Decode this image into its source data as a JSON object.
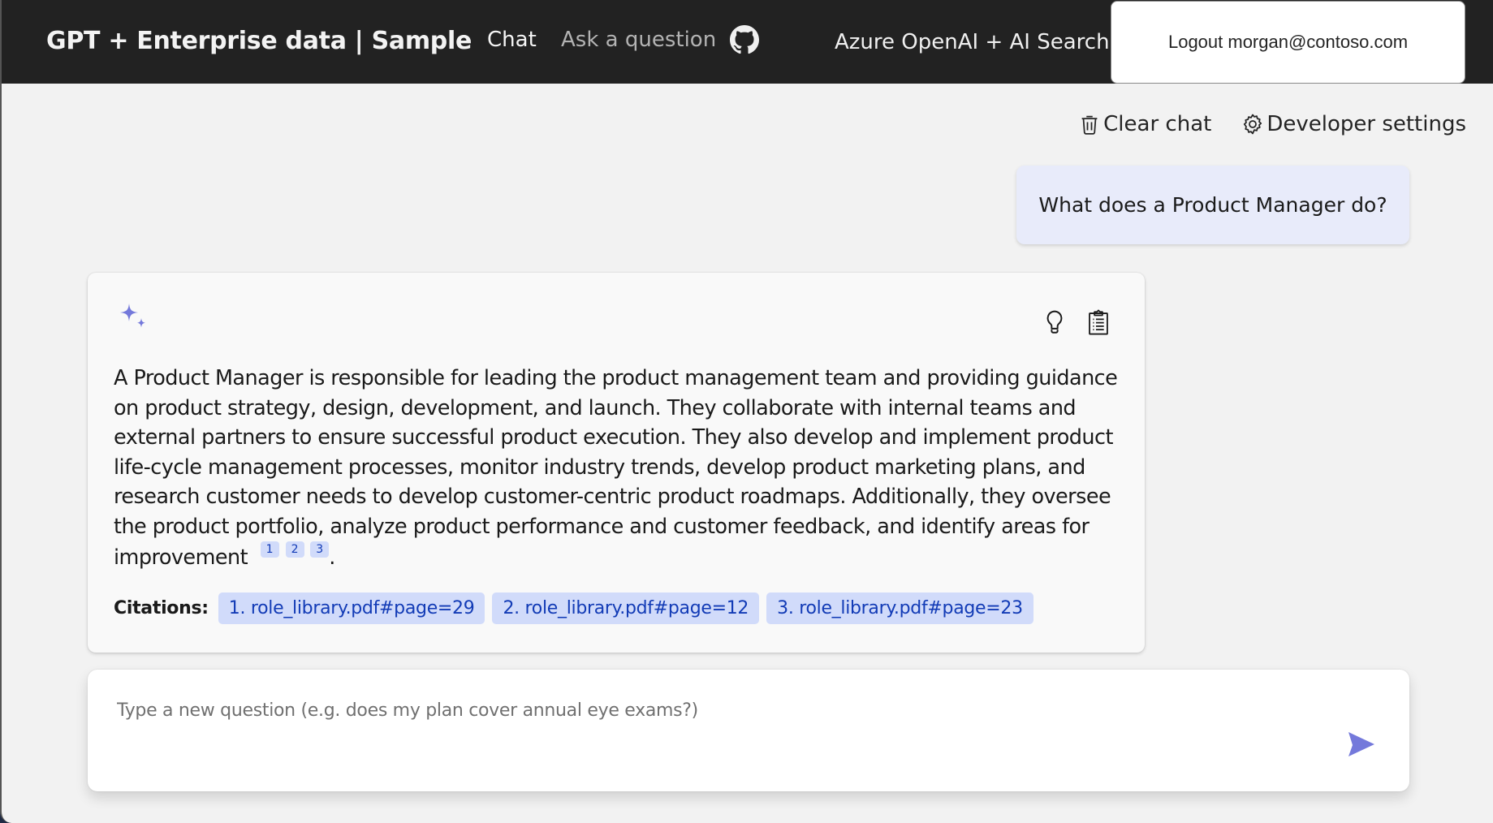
{
  "header": {
    "title": "GPT + Enterprise data | Sample",
    "nav": [
      {
        "label": "Chat",
        "active": true
      },
      {
        "label": "Ask a question",
        "active": false
      }
    ],
    "github_icon": "github-icon",
    "right_label": "Azure OpenAI + AI Search",
    "logout_label": "Logout morgan@contoso.com"
  },
  "toolbar": {
    "clear_chat": {
      "label": "Clear chat",
      "icon": "trash-icon"
    },
    "developer_settings": {
      "label": "Developer settings",
      "icon": "gear-icon"
    }
  },
  "conversation": {
    "user_message": "What does a Product Manager do?",
    "answer": {
      "icon": "sparkle-icon",
      "actions": [
        {
          "name": "thought-process",
          "icon": "lightbulb-icon"
        },
        {
          "name": "supporting-content",
          "icon": "clipboard-icon"
        }
      ],
      "text": "A Product Manager is responsible for leading the product management team and providing guidance on product strategy, design, development, and launch. They collaborate with internal teams and external partners to ensure successful product execution. They also develop and implement product life-cycle management processes, monitor industry trends, develop product marketing plans, and research customer needs to develop customer-centric product roadmaps. Additionally, they oversee the product portfolio, analyze product performance and customer feedback, and identify areas for improvement",
      "superscripts": [
        "1",
        "2",
        "3"
      ],
      "trailing": ".",
      "citations_label": "Citations:",
      "citations": [
        "1. role_library.pdf#page=29",
        "2. role_library.pdf#page=12",
        "3. role_library.pdf#page=23"
      ]
    }
  },
  "input": {
    "value": "",
    "placeholder": "Type a new question (e.g. does my plan cover annual eye exams?)",
    "send_icon": "send-icon"
  },
  "colors": {
    "header_bg": "#222222",
    "accent": "#7479DB",
    "citation_bg": "#D1DBFA",
    "citation_text": "#123BB6",
    "user_bubble_bg": "#E8EBFA"
  }
}
